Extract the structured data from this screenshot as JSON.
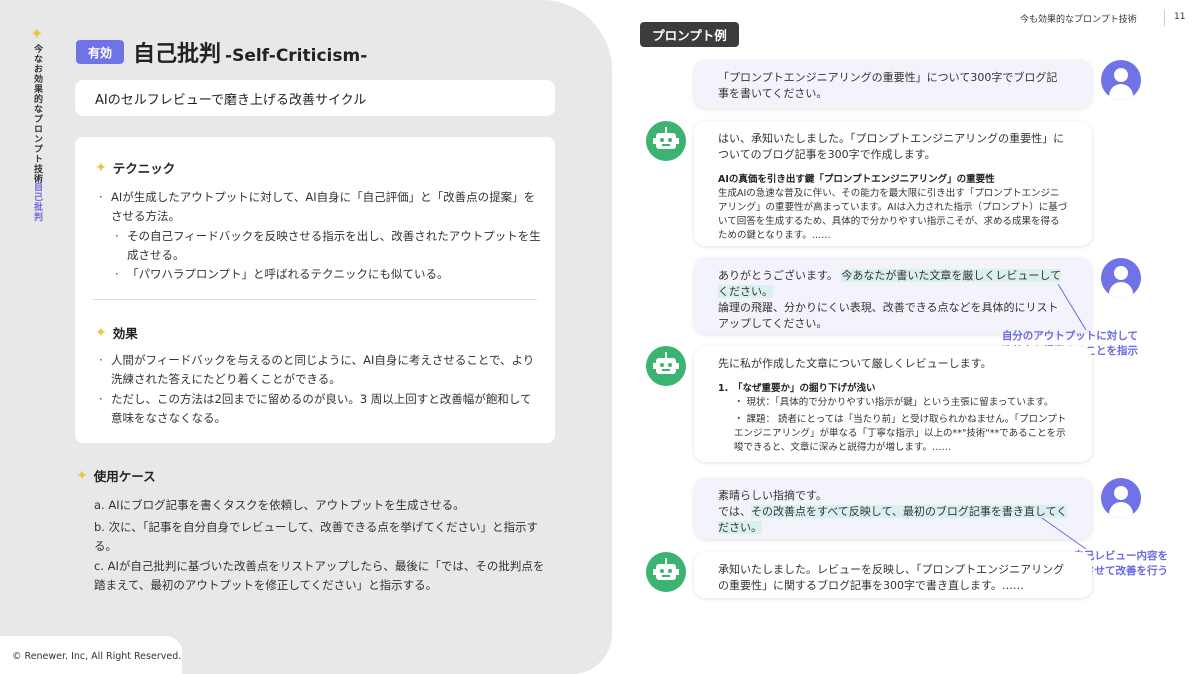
{
  "side": {
    "vertical_label": "今なお効果的なプロンプト技術",
    "vertical_section": "自己批判"
  },
  "header": {
    "title": "今も効果的なプロンプト技術",
    "page_number": "11"
  },
  "title": {
    "badge": "有効",
    "main": "自己批判",
    "english": "-Self-Criticism-"
  },
  "subtitle": "AIのセルフレビューで磨き上げる改善サイクル",
  "technique": {
    "heading": "テクニック",
    "bullets": {
      "b1": "AIが生成したアウトプットに対して、AI自身に「自己評価」と「改善点の提案」をさせる方法。",
      "b2": "その自己フィードバックを反映させる指示を出し、改善されたアウトプットを生成させる。",
      "b3": "「パワハラプロンプト」と呼ばれるテクニックにも似ている。"
    }
  },
  "effect": {
    "heading": "効果",
    "bullets": {
      "b1": "人間がフィードバックを与えるのと同じように、AI自身に考えさせることで、より洗練された答えにたどり着くことができる。",
      "b2": "ただし、この方法は2回までに留めるのが良い。3 周以上回すと改善幅が飽和して意味をなさなくなる。"
    }
  },
  "use_case": {
    "heading": "使用ケース",
    "items": {
      "a": "a. AIにブログ記事を書くタスクを依頼し、アウトプットを生成させる。",
      "b": "b. 次に、「記事を自分自身でレビューして、改善できる点を挙げてください」と指示する。",
      "c": "c. AIが自己批判に基づいた改善点をリストアップしたら、最後に「では、その批判点を踏まえて、最初のアウトプットを修正してください」と指示する。"
    }
  },
  "footer": {
    "copyright": "© Renewer. Inc, All Right Reserved."
  },
  "example": {
    "tag": "プロンプト例",
    "m1": "「プロンプトエンジニアリングの重要性」について300字でブログ記事を書いてください。",
    "m2_intro": "はい、承知いたしました。「プロンプトエンジニアリングの重要性」についてのブログ記事を300字で作成します。",
    "m2_heading": "AIの真価を引き出す鍵「プロンプトエンジニアリング」の重要性",
    "m2_body": "生成AIの急速な普及に伴い、その能力を最大限に引き出す「プロンプトエンジニアリング」の重要性が高まっています。AIは入力された指示（プロンプト）に基づいて回答を生成するため、具体的で分かりやすい指示こそが、求める成果を得るための鍵となります。……",
    "m3_a": "ありがとうございます。",
    "m3_hl": "今あなたが書いた文章を厳しくレビューしてください。",
    "m3_b": "論理の飛躍、分かりにくい表現、改善できる点などを具体的にリストアップしてください。",
    "m4_intro": "先に私が作成した文章について厳しくレビューします。",
    "m4_point": "1.　「なぜ重要か」の掘り下げが浅い",
    "m4_sub1": "・ 現状：「具体的で分かりやすい指示が鍵」という主張に留まっています。",
    "m4_sub2": "・ 課題： 読者にとっては「当たり前」と受け取られかねません。「プロンプトエンジニアリング」が単なる「丁寧な指示」以上の**\"技術\"**であることを示唆できると、文章に深みと説得力が増します。……",
    "m5_a": "素晴らしい指摘です。",
    "m5_b": "では、",
    "m5_hl": "その改善点をすべて反映して、最初のブログ記事を書き直してください。",
    "m6": "承知いたしました。レビューを反映し、「プロンプトエンジニアリングの重要性」に関するブログ記事を300字で書き直します。……",
    "annot1": "自分のアウトプットに対して\n改善点を提案することを指示",
    "annot2": "自己レビュー内容を\n反映させて改善を行う"
  },
  "colors": {
    "accent": "#6f73e6",
    "bot": "#3cb371",
    "highlight": "#d9f0ee",
    "star": "#f0c24a"
  }
}
